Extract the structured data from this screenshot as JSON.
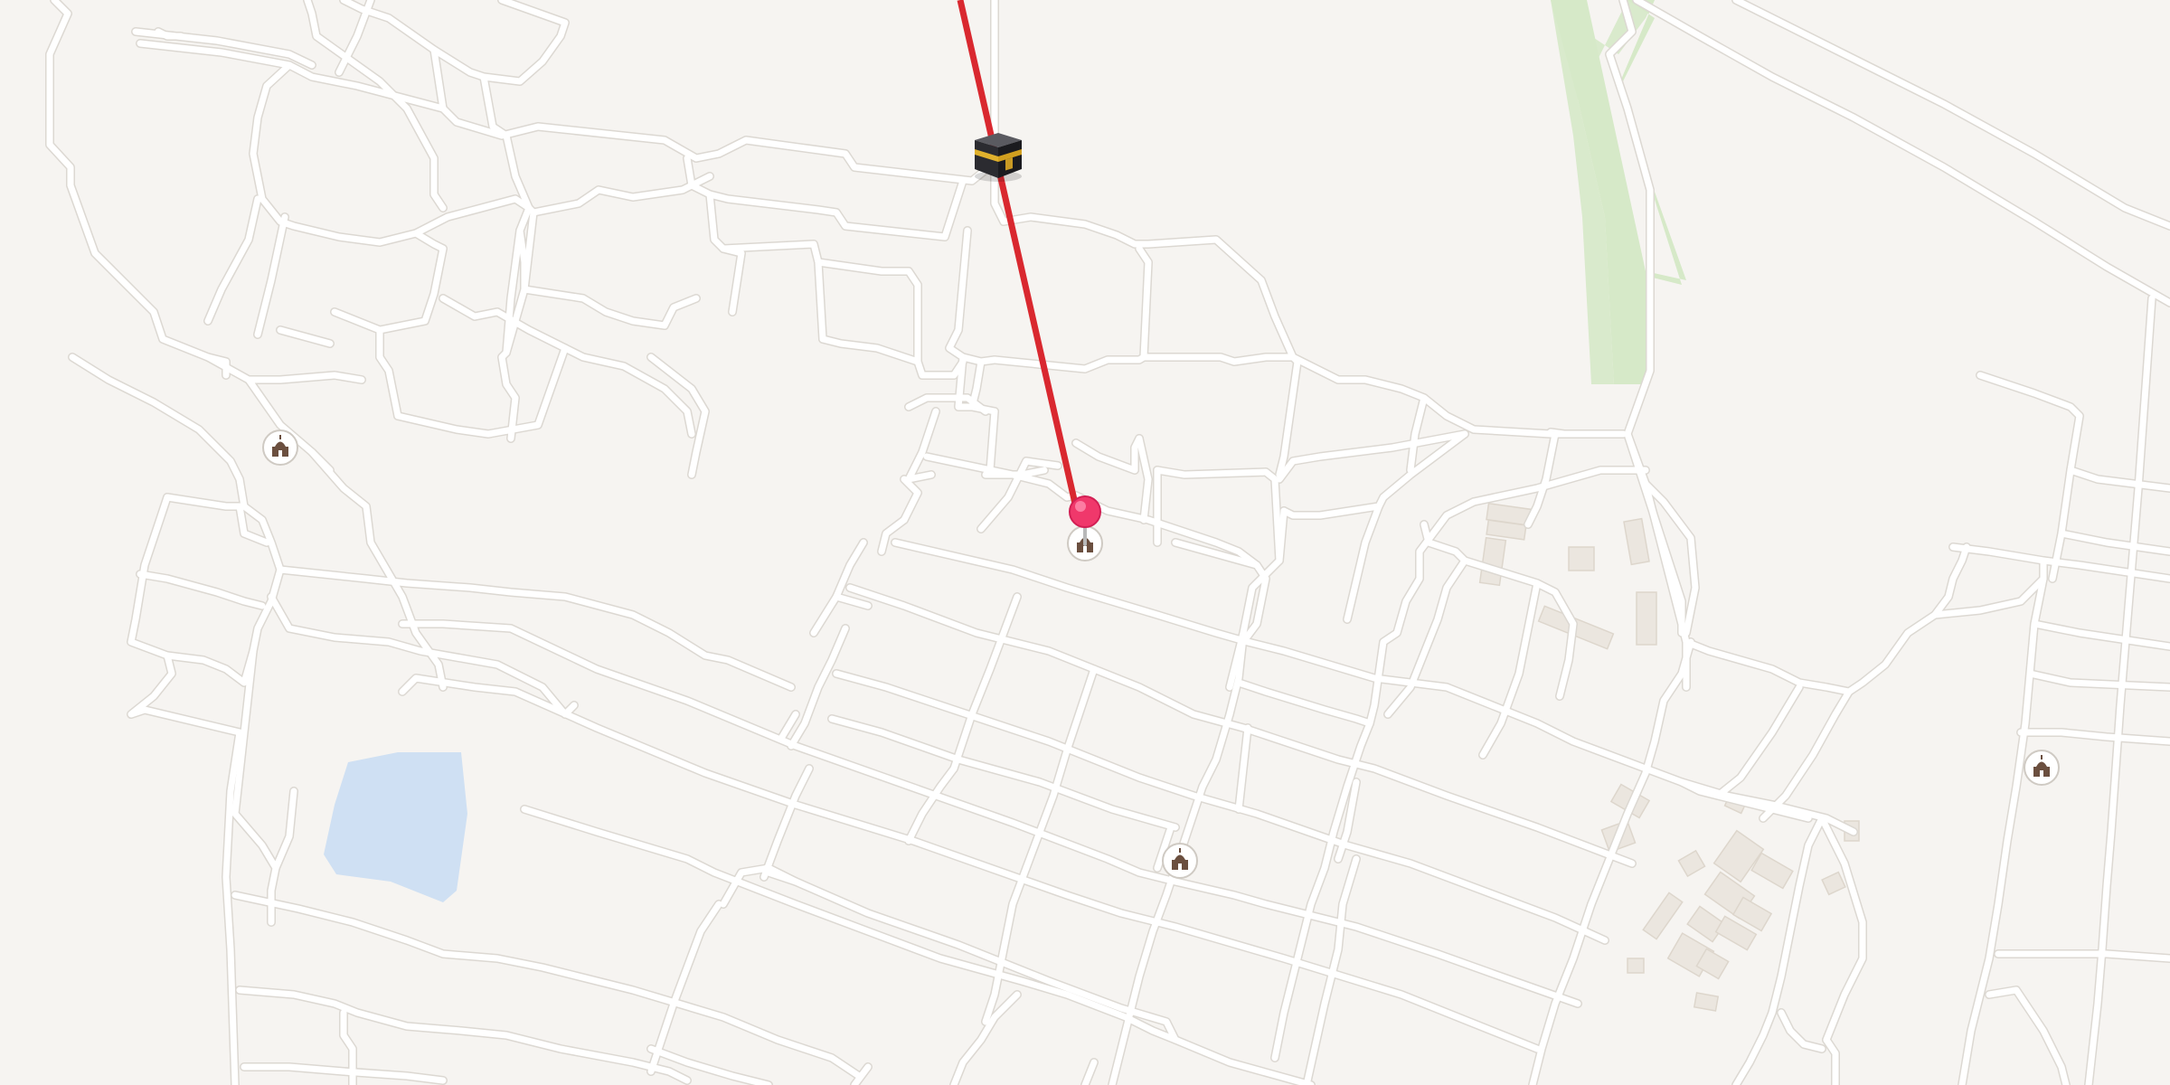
{
  "map": {
    "background_color": "#f6f4f1",
    "road_color": "#ffffff",
    "park_color": "#d6e9c8",
    "water_color": "#cfe0f3",
    "building_color": "#ebe6df",
    "qibla_line_color": "#d9282f",
    "pin_color": "#f0386b"
  },
  "qibla": {
    "kaaba_icon": "kaaba-icon",
    "direction_line": "qibla-direction-line"
  },
  "location_pin": {
    "icon": "location-pin-icon"
  },
  "mosques": [
    {
      "icon": "mosque-icon"
    },
    {
      "icon": "mosque-icon"
    },
    {
      "icon": "mosque-icon"
    },
    {
      "icon": "mosque-icon"
    }
  ]
}
